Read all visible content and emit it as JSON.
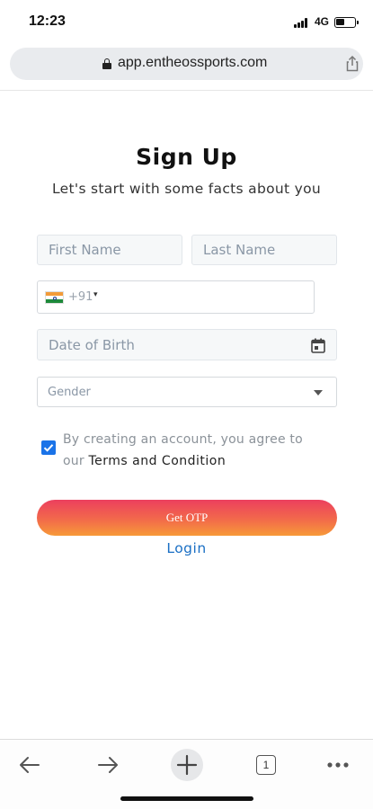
{
  "status_bar": {
    "time": "12:23",
    "network": "4G"
  },
  "browser": {
    "url": "app.entheossports.com",
    "tab_count": "1"
  },
  "form": {
    "title": "Sign Up",
    "subtitle": "Let's start with some facts about you",
    "first_name_placeholder": "First Name",
    "last_name_placeholder": "Last Name",
    "phone": {
      "country": "India",
      "flag_icon": "india-flag-icon",
      "dial_code": "+91",
      "caret": "▾",
      "value": ""
    },
    "dob_placeholder": "Date of Birth",
    "gender_placeholder": "Gender",
    "terms_checked": true,
    "agree_prefix": "By creating an account, you agree to our",
    "terms_link": "Terms and Condition",
    "submit_label": "Get OTP",
    "login_label": "Login"
  },
  "colors": {
    "button_gradient": [
      "#ec3f5e",
      "#f79a39"
    ],
    "link": "#1a6fc4",
    "checkbox": "#1a73e8"
  },
  "toolbar": {
    "icons": [
      "back-arrow-icon",
      "forward-arrow-icon",
      "plus-icon",
      "tabs-icon",
      "more-icon"
    ]
  }
}
